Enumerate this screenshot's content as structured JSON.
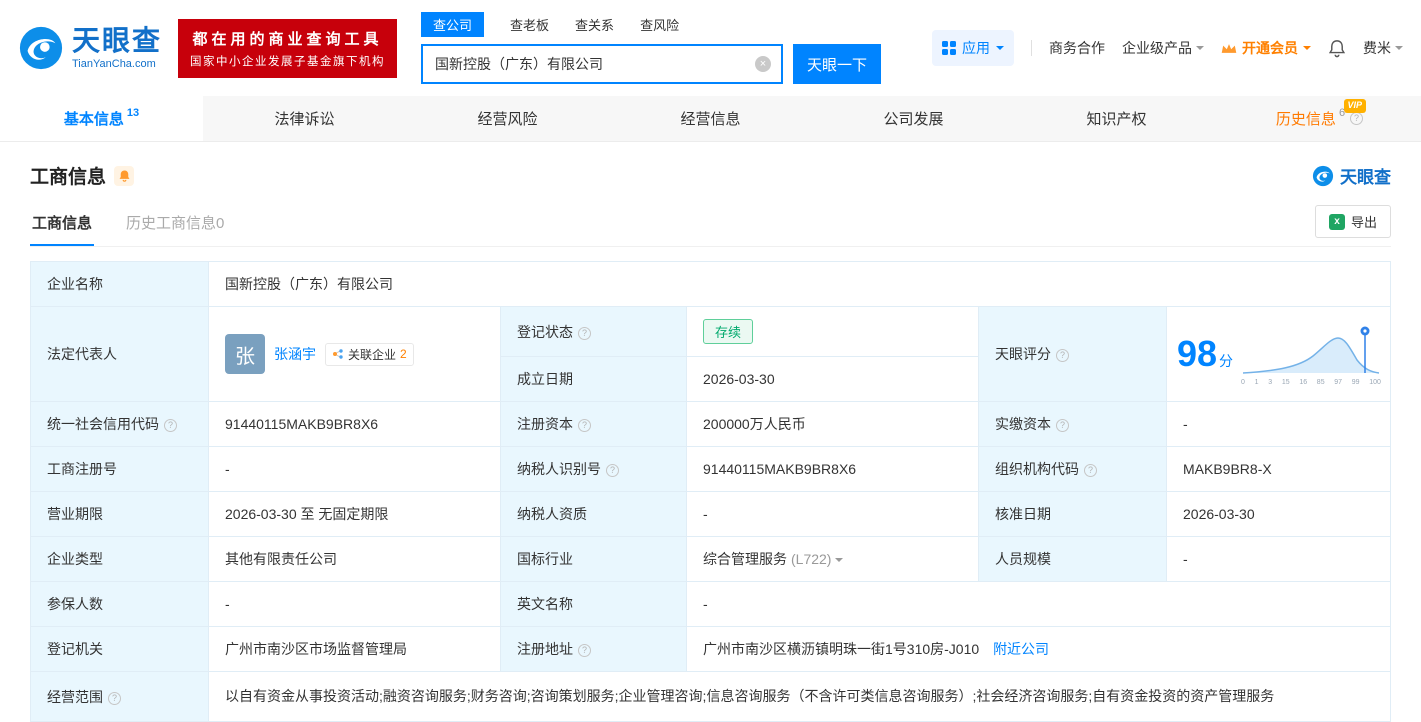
{
  "brand": {
    "name": "天眼查",
    "domain": "TianYanCha.com",
    "slogan_line1": "都在用的商业查询工具",
    "slogan_line2": "国家中小企业发展子基金旗下机构",
    "corner_logo": "天眼查"
  },
  "search": {
    "tabs": [
      {
        "label": "查公司"
      },
      {
        "label": "查老板"
      },
      {
        "label": "查关系"
      },
      {
        "label": "查风险"
      }
    ],
    "value": "国新控股（广东）有限公司",
    "button": "天眼一下"
  },
  "topmenu": {
    "apps": "应用",
    "biz": "商务合作",
    "enterprise": "企业级产品",
    "vip": "开通会员",
    "user": "费米"
  },
  "nav": {
    "tabs": [
      {
        "label": "基本信息",
        "count": "13"
      },
      {
        "label": "法律诉讼",
        "count": ""
      },
      {
        "label": "经营风险",
        "count": ""
      },
      {
        "label": "经营信息",
        "count": ""
      },
      {
        "label": "公司发展",
        "count": ""
      },
      {
        "label": "知识产权",
        "count": ""
      },
      {
        "label": "历史信息",
        "count": "6",
        "vip": "VIP"
      }
    ]
  },
  "section": {
    "title": "工商信息",
    "subtab_active": "工商信息",
    "subtab_history": "历史工商信息0",
    "export": "导出"
  },
  "table": {
    "company_name": {
      "label": "企业名称",
      "value": "国新控股（广东）有限公司"
    },
    "legal_rep": {
      "label": "法定代表人",
      "avatar": "张",
      "name": "张涵宇",
      "badge": "关联企业",
      "badge_count": "2"
    },
    "reg_status": {
      "label": "登记状态",
      "value": "存续"
    },
    "establish_date": {
      "label": "成立日期",
      "value": "2026-03-30"
    },
    "score": {
      "label": "天眼评分",
      "value": "98",
      "unit": "分",
      "ticks": [
        "0",
        "1",
        "3",
        "15",
        "16",
        "85",
        "97",
        "99",
        "100"
      ]
    },
    "credit_code": {
      "label": "统一社会信用代码",
      "value": "91440115MAKB9BR8X6"
    },
    "reg_capital": {
      "label": "注册资本",
      "value": "200000万人民币"
    },
    "paid_capital": {
      "label": "实缴资本",
      "value": "-"
    },
    "reg_no": {
      "label": "工商注册号",
      "value": "-"
    },
    "taxpayer_no": {
      "label": "纳税人识别号",
      "value": "91440115MAKB9BR8X6"
    },
    "org_code": {
      "label": "组织机构代码",
      "value": "MAKB9BR8-X"
    },
    "term": {
      "label": "营业期限",
      "value": "2026-03-30 至 无固定期限"
    },
    "taxpayer_quality": {
      "label": "纳税人资质",
      "value": "-"
    },
    "approve_date": {
      "label": "核准日期",
      "value": "2026-03-30"
    },
    "company_type": {
      "label": "企业类型",
      "value": "其他有限责任公司"
    },
    "industry": {
      "label": "国标行业",
      "value": "综合管理服务",
      "code": "(L722)"
    },
    "staff_size": {
      "label": "人员规模",
      "value": "-"
    },
    "insured": {
      "label": "参保人数",
      "value": "-"
    },
    "en_name": {
      "label": "英文名称",
      "value": "-"
    },
    "authority": {
      "label": "登记机关",
      "value": "广州市南沙区市场监督管理局"
    },
    "address": {
      "label": "注册地址",
      "value": "广州市南沙区横沥镇明珠一街1号310房-J010",
      "link": "附近公司"
    },
    "scope": {
      "label": "经营范围",
      "value": "以自有资金从事投资活动;融资咨询服务;财务咨询;咨询策划服务;企业管理咨询;信息咨询服务（不含许可类信息咨询服务）;社会经济咨询服务;自有资金投资的资产管理服务"
    }
  }
}
